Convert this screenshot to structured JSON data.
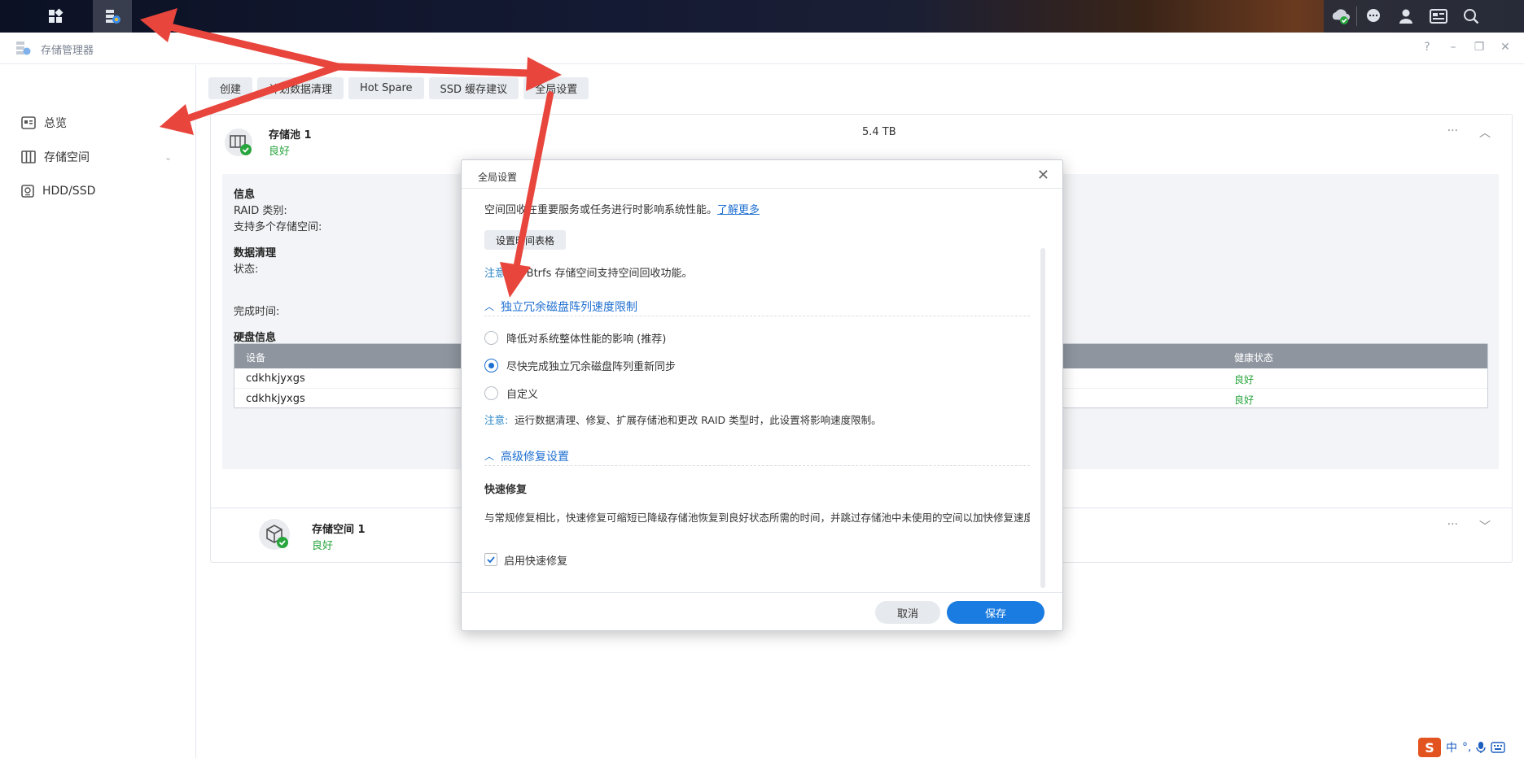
{
  "window": {
    "title": "存储管理器"
  },
  "sidebar": {
    "items": [
      {
        "label": "总览",
        "icon": "overview-icon"
      },
      {
        "label": "存储空间",
        "icon": "storage-icon"
      },
      {
        "label": "HDD/SSD",
        "icon": "disk-icon"
      }
    ]
  },
  "toolbar": {
    "buttons": [
      "创建",
      "计划数据清理",
      "Hot Spare",
      "SSD 缓存建议",
      "全局设置"
    ]
  },
  "pool": {
    "name": "存储池 1",
    "status": "良好",
    "size": "5.4 TB",
    "info": {
      "heading": "信息",
      "raid_label": "RAID 类别:",
      "multi_label": "支持多个存储空间:",
      "scrub_heading": "数据清理",
      "state_label": "状态:",
      "done_label": "完成时间:",
      "disk_heading": "硬盘信息"
    },
    "disk_table": {
      "col_device": "设备",
      "col_health": "健康状态",
      "rows": [
        {
          "device": "cdkhkjyxgs",
          "health": "良好"
        },
        {
          "device": "cdkhkjyxgs",
          "health": "良好"
        }
      ]
    }
  },
  "volume": {
    "name": "存储空间 1",
    "status": "良好"
  },
  "dialog": {
    "title": "全局设置",
    "intro": "空间回收在重要服务或任务进行时影响系统性能。",
    "learn_more": "了解更多",
    "schedule_btn": "设置时间表格",
    "note1_label": "注意:",
    "note1_text": "仅 Btrfs 存储空间支持空间回收功能。",
    "raid_section": "独立冗余磁盘阵列速度限制",
    "options": [
      {
        "label": "降低对系统整体性能的影响 (推荐)",
        "selected": false
      },
      {
        "label": "尽快完成独立冗余磁盘阵列重新同步",
        "selected": true
      },
      {
        "label": "自定义",
        "selected": false
      }
    ],
    "note2_label": "注意:",
    "note2_text": "运行数据清理、修复、扩展存储池和更改 RAID 类型时，此设置将影响速度限制。",
    "adv_section": "高级修复设置",
    "fast_heading": "快速修复",
    "fast_desc": "与常规修复相比，快速修复可缩短已降级存储池恢复到良好状态所需的时间，并跳过存储池中未使用的空间以加快修复速度。",
    "fast_enable": "启用快速修复",
    "fast_checked": true,
    "cancel": "取消",
    "save": "保存"
  },
  "ime": {
    "lang": "中",
    "punct": "°,"
  },
  "colors": {
    "accent": "#1a7be0",
    "good": "#29a53e",
    "arrow": "#e8453c"
  }
}
